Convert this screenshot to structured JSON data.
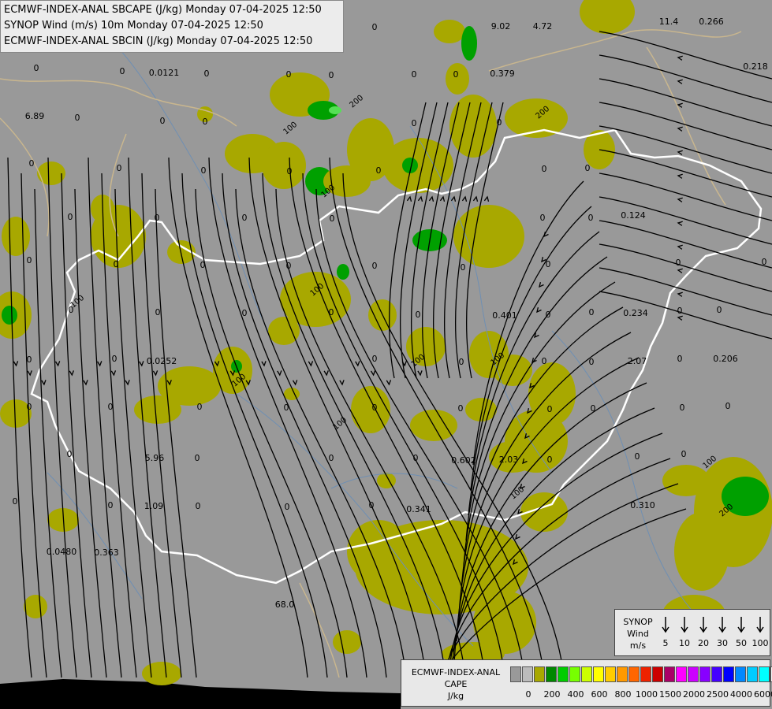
{
  "header": {
    "line1": "ECMWF-INDEX-ANAL SBCAPE (J/kg) Monday 07-04-2025 12:50",
    "line2": "SYNOP Wind (m/s) 10m Monday 07-04-2025 12:50",
    "line3": "ECMWF-INDEX-ANAL SBCIN (J/kg) Monday 07-04-2025 12:50"
  },
  "colors": {
    "background": "#999999",
    "border_white": "#ffffff",
    "river": "#6f8fb3",
    "region_border": "#c9b68e",
    "cape_olive": "#a8a800",
    "cape_green": "#00a000",
    "cape_light": "#55e055"
  },
  "legend_wind": {
    "title": "SYNOP Wind m/s",
    "title_lines": [
      "SYNOP",
      "Wind",
      "m/s"
    ],
    "values": [
      "5",
      "10",
      "20",
      "30",
      "50",
      "100"
    ]
  },
  "legend_cape": {
    "title_lines": [
      "ECMWF-INDEX-ANAL",
      "CAPE",
      "J/kg"
    ],
    "colors": [
      "#999999",
      "#bbbbbb",
      "#a8a800",
      "#008800",
      "#00cc00",
      "#77ff00",
      "#ccff00",
      "#ffff00",
      "#ffcc00",
      "#ff9900",
      "#ff6600",
      "#ee2200",
      "#cc0000",
      "#aa0066",
      "#ff00ff",
      "#cc00ff",
      "#8800ff",
      "#4400ff",
      "#0000ff",
      "#0088ff",
      "#00ccff",
      "#00ffff",
      "#ffffff"
    ],
    "ticks": [
      "0",
      "200",
      "400",
      "600",
      "800",
      "1000",
      "1500",
      "2000",
      "2500",
      "4000",
      "6000"
    ]
  },
  "map_labels": [
    {
      "t": "9.02"
    },
    {
      "t": "4.72"
    },
    {
      "t": "11.4"
    },
    {
      "t": "0.266"
    },
    {
      "t": "0.218"
    },
    {
      "t": "0.0121"
    },
    {
      "t": "6.89"
    },
    {
      "t": "0.379"
    },
    {
      "t": "0.124"
    },
    {
      "t": "0.401"
    },
    {
      "t": "0.234"
    },
    {
      "t": "0.206"
    },
    {
      "t": "2.07"
    },
    {
      "t": "0.0252"
    },
    {
      "t": "5.96"
    },
    {
      "t": "0.602"
    },
    {
      "t": "2.03"
    },
    {
      "t": "1.09"
    },
    {
      "t": "0.341"
    },
    {
      "t": "0.310"
    },
    {
      "t": "0.0480"
    },
    {
      "t": "0.363"
    },
    {
      "t": "68.0"
    },
    {
      "t": "0"
    },
    {
      "t": "0"
    },
    {
      "t": "0"
    },
    {
      "t": "0"
    },
    {
      "t": "0"
    },
    {
      "t": "0"
    },
    {
      "t": "0"
    },
    {
      "t": "0"
    },
    {
      "t": "0"
    },
    {
      "t": "0"
    },
    {
      "t": "0"
    },
    {
      "t": "0"
    },
    {
      "t": "0"
    },
    {
      "t": "0"
    },
    {
      "t": "0"
    },
    {
      "t": "0"
    },
    {
      "t": "0"
    },
    {
      "t": "0"
    },
    {
      "t": "0"
    },
    {
      "t": "0"
    },
    {
      "t": "0"
    },
    {
      "t": "0"
    },
    {
      "t": "0"
    },
    {
      "t": "0"
    },
    {
      "t": "0"
    },
    {
      "t": "0"
    },
    {
      "t": "0"
    },
    {
      "t": "0"
    },
    {
      "t": "0"
    },
    {
      "t": "0"
    },
    {
      "t": "0"
    },
    {
      "t": "0"
    },
    {
      "t": "0"
    },
    {
      "t": "0"
    },
    {
      "t": "0"
    },
    {
      "t": "0"
    },
    {
      "t": "0"
    },
    {
      "t": "0"
    },
    {
      "t": "0"
    },
    {
      "t": "0"
    },
    {
      "t": "0"
    },
    {
      "t": "0"
    },
    {
      "t": "0"
    },
    {
      "t": "0"
    },
    {
      "t": "0"
    },
    {
      "t": "0"
    },
    {
      "t": "0"
    },
    {
      "t": "0"
    },
    {
      "t": "0"
    },
    {
      "t": "0"
    },
    {
      "t": "0"
    },
    {
      "t": "0"
    },
    {
      "t": "0"
    },
    {
      "t": "0"
    },
    {
      "t": "0"
    },
    {
      "t": "0"
    },
    {
      "t": "0"
    },
    {
      "t": "0"
    },
    {
      "t": "0"
    },
    {
      "t": "0"
    },
    {
      "t": "0"
    },
    {
      "t": "0"
    },
    {
      "t": "0"
    },
    {
      "t": "0"
    },
    {
      "t": "0"
    },
    {
      "t": "0"
    },
    {
      "t": "0"
    },
    {
      "t": "0"
    },
    {
      "t": "0"
    },
    {
      "t": "0"
    },
    {
      "t": "0"
    },
    {
      "t": "0"
    },
    {
      "t": "0"
    },
    {
      "t": "0"
    },
    {
      "t": "0"
    },
    {
      "t": "0"
    },
    {
      "t": "0"
    },
    {
      "t": "0"
    },
    {
      "t": "0"
    },
    {
      "t": "0"
    }
  ],
  "contour_labels": [
    "100",
    "100",
    "100",
    "100",
    "100",
    "100",
    "100",
    "100",
    "100",
    "100",
    "200",
    "200",
    "200"
  ]
}
